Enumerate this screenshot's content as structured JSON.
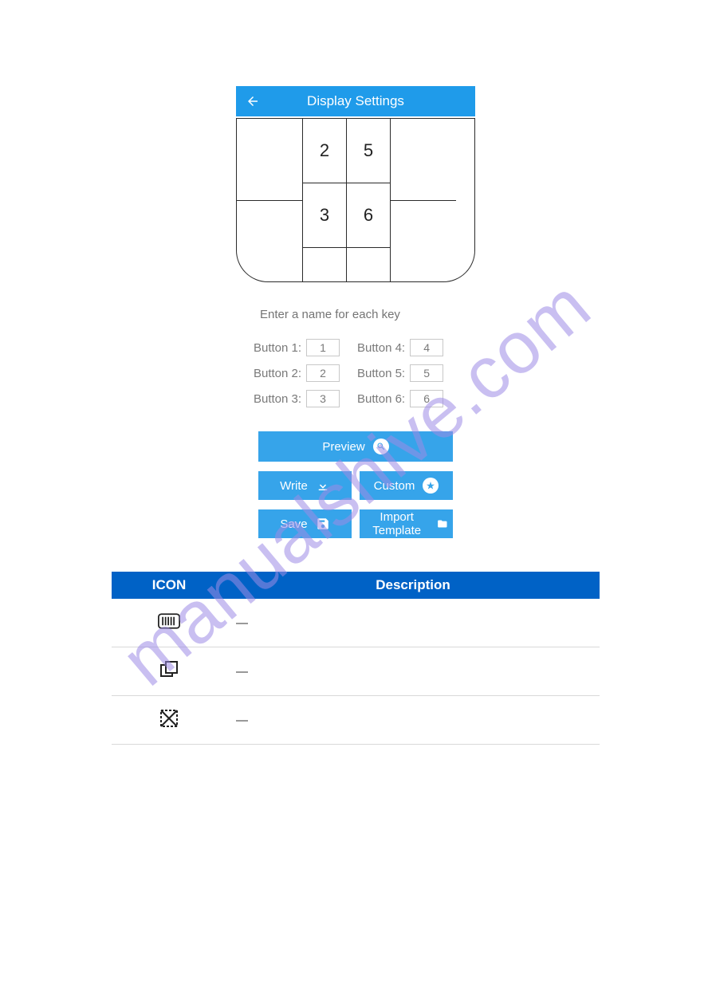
{
  "watermark": "manualshive.com",
  "mock": {
    "title": "Display Settings",
    "grid": {
      "col2": [
        "2",
        "3"
      ],
      "col3": [
        "5",
        "6"
      ]
    },
    "hint": "Enter a name for each key",
    "inputs": [
      {
        "label": "Button 1:",
        "value": "1"
      },
      {
        "label": "Button 2:",
        "value": "2"
      },
      {
        "label": "Button 3:",
        "value": "3"
      },
      {
        "label": "Button 4:",
        "value": "4"
      },
      {
        "label": "Button 5:",
        "value": "5"
      },
      {
        "label": "Button 6:",
        "value": "6"
      }
    ],
    "actions": {
      "preview": "Preview",
      "write": "Write",
      "custom": "Custom",
      "save": "Save",
      "import": "Import Template"
    }
  },
  "table": {
    "headers": [
      "ICON",
      "Description"
    ],
    "rows": [
      {
        "icon": "barcode-icon",
        "desc": "—"
      },
      {
        "icon": "copy-icon",
        "desc": "—"
      },
      {
        "icon": "no-image-icon",
        "desc": "—"
      }
    ]
  }
}
